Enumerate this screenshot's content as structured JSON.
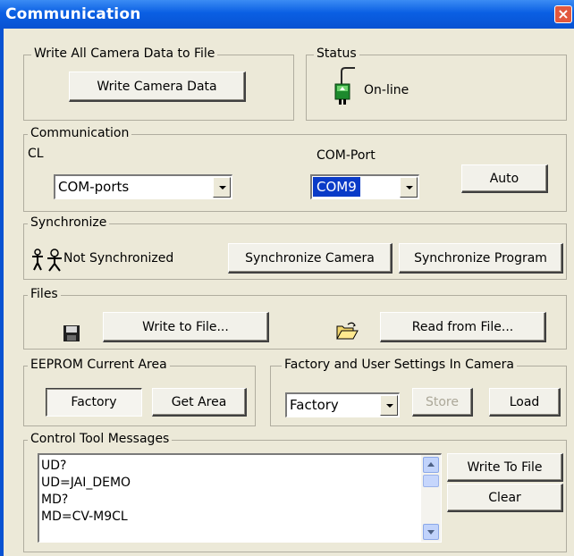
{
  "window": {
    "title": "Communication",
    "close_glyph": "×"
  },
  "write_all": {
    "legend": "Write All Camera Data to File",
    "button": "Write Camera Data"
  },
  "status": {
    "legend": "Status",
    "text": "On-line",
    "icon": "online-plug-icon"
  },
  "communication": {
    "legend": "Communication",
    "cl_label": "CL",
    "cl_value": "COM-ports",
    "comport_label": "COM-Port",
    "comport_value": "COM9",
    "auto_button": "Auto"
  },
  "synchronize": {
    "legend": "Synchronize",
    "status_text": "Not Synchronized",
    "icon": "people-not-synchronized-icon",
    "sync_camera_button": "Synchronize Camera",
    "sync_program_button": "Synchronize Program"
  },
  "files": {
    "legend": "Files",
    "write_button": "Write to File...",
    "read_button": "Read from File...",
    "save_icon": "floppy-disk-icon",
    "open_icon": "open-folder-icon"
  },
  "eeprom": {
    "legend": "EEPROM Current Area",
    "factory_button": "Factory",
    "get_area_button": "Get Area"
  },
  "settings": {
    "legend": "Factory and User Settings In Camera",
    "select_value": "Factory",
    "store_button": "Store",
    "load_button": "Load"
  },
  "messages": {
    "legend": "Control Tool Messages",
    "lines": [
      "UD?",
      "UD=JAI_DEMO",
      "MD?",
      "MD=CV-M9CL"
    ],
    "write_button": "Write To File",
    "clear_button": "Clear"
  },
  "colors": {
    "title_bar": "#0852d2",
    "dialog_bg": "#ece9d8",
    "selection": "#0a3bc8",
    "close": "#e2583e"
  }
}
